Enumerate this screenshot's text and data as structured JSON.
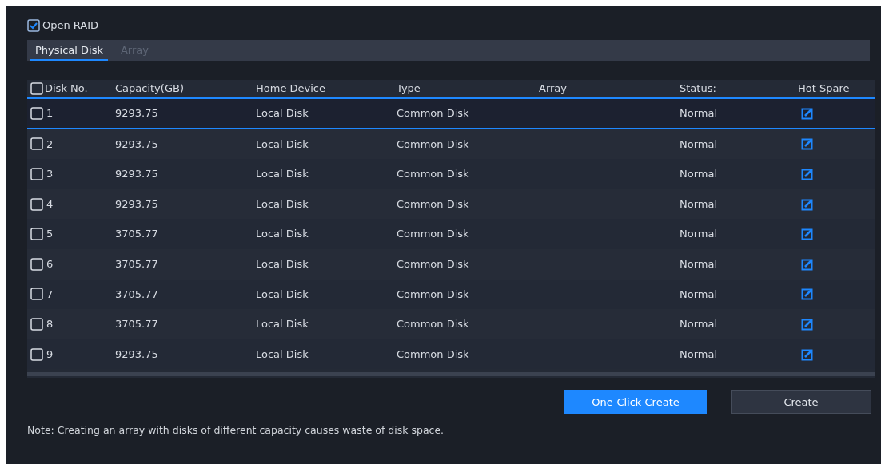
{
  "open_raid": {
    "label": "Open RAID",
    "checked": true
  },
  "tabs": [
    {
      "label": "Physical Disk",
      "selected": true
    },
    {
      "label": "Array",
      "selected": false
    }
  ],
  "table": {
    "select_all": {
      "checked": false
    },
    "columns": [
      "Disk No.",
      "Capacity(GB)",
      "Home Device",
      "Type",
      "Array",
      "Status:",
      "Hot Spare"
    ],
    "rows": [
      {
        "checked": false,
        "selected": true,
        "disk_no": "1",
        "capacity": "9293.75",
        "home_device": "Local Disk",
        "type": "Common Disk",
        "status": "Normal"
      },
      {
        "checked": false,
        "selected": false,
        "disk_no": "2",
        "capacity": "9293.75",
        "home_device": "Local Disk",
        "type": "Common Disk",
        "status": "Normal"
      },
      {
        "checked": false,
        "selected": false,
        "disk_no": "3",
        "capacity": "9293.75",
        "home_device": "Local Disk",
        "type": "Common Disk",
        "status": "Normal"
      },
      {
        "checked": false,
        "selected": false,
        "disk_no": "4",
        "capacity": "9293.75",
        "home_device": "Local Disk",
        "type": "Common Disk",
        "status": "Normal"
      },
      {
        "checked": false,
        "selected": false,
        "disk_no": "5",
        "capacity": "3705.77",
        "home_device": "Local Disk",
        "type": "Common Disk",
        "status": "Normal"
      },
      {
        "checked": false,
        "selected": false,
        "disk_no": "6",
        "capacity": "3705.77",
        "home_device": "Local Disk",
        "type": "Common Disk",
        "status": "Normal"
      },
      {
        "checked": false,
        "selected": false,
        "disk_no": "7",
        "capacity": "3705.77",
        "home_device": "Local Disk",
        "type": "Common Disk",
        "status": "Normal"
      },
      {
        "checked": false,
        "selected": false,
        "disk_no": "8",
        "capacity": "3705.77",
        "home_device": "Local Disk",
        "type": "Common Disk",
        "status": "Normal"
      },
      {
        "checked": false,
        "selected": false,
        "disk_no": "9",
        "capacity": "9293.75",
        "home_device": "Local Disk",
        "type": "Common Disk",
        "status": "Normal"
      }
    ]
  },
  "buttons": [
    {
      "label": "One-Click Create",
      "kind": "primary"
    },
    {
      "label": "Create",
      "kind": "secondary"
    }
  ],
  "note": "Note: Creating an array with disks of different capacity causes waste of disk space."
}
